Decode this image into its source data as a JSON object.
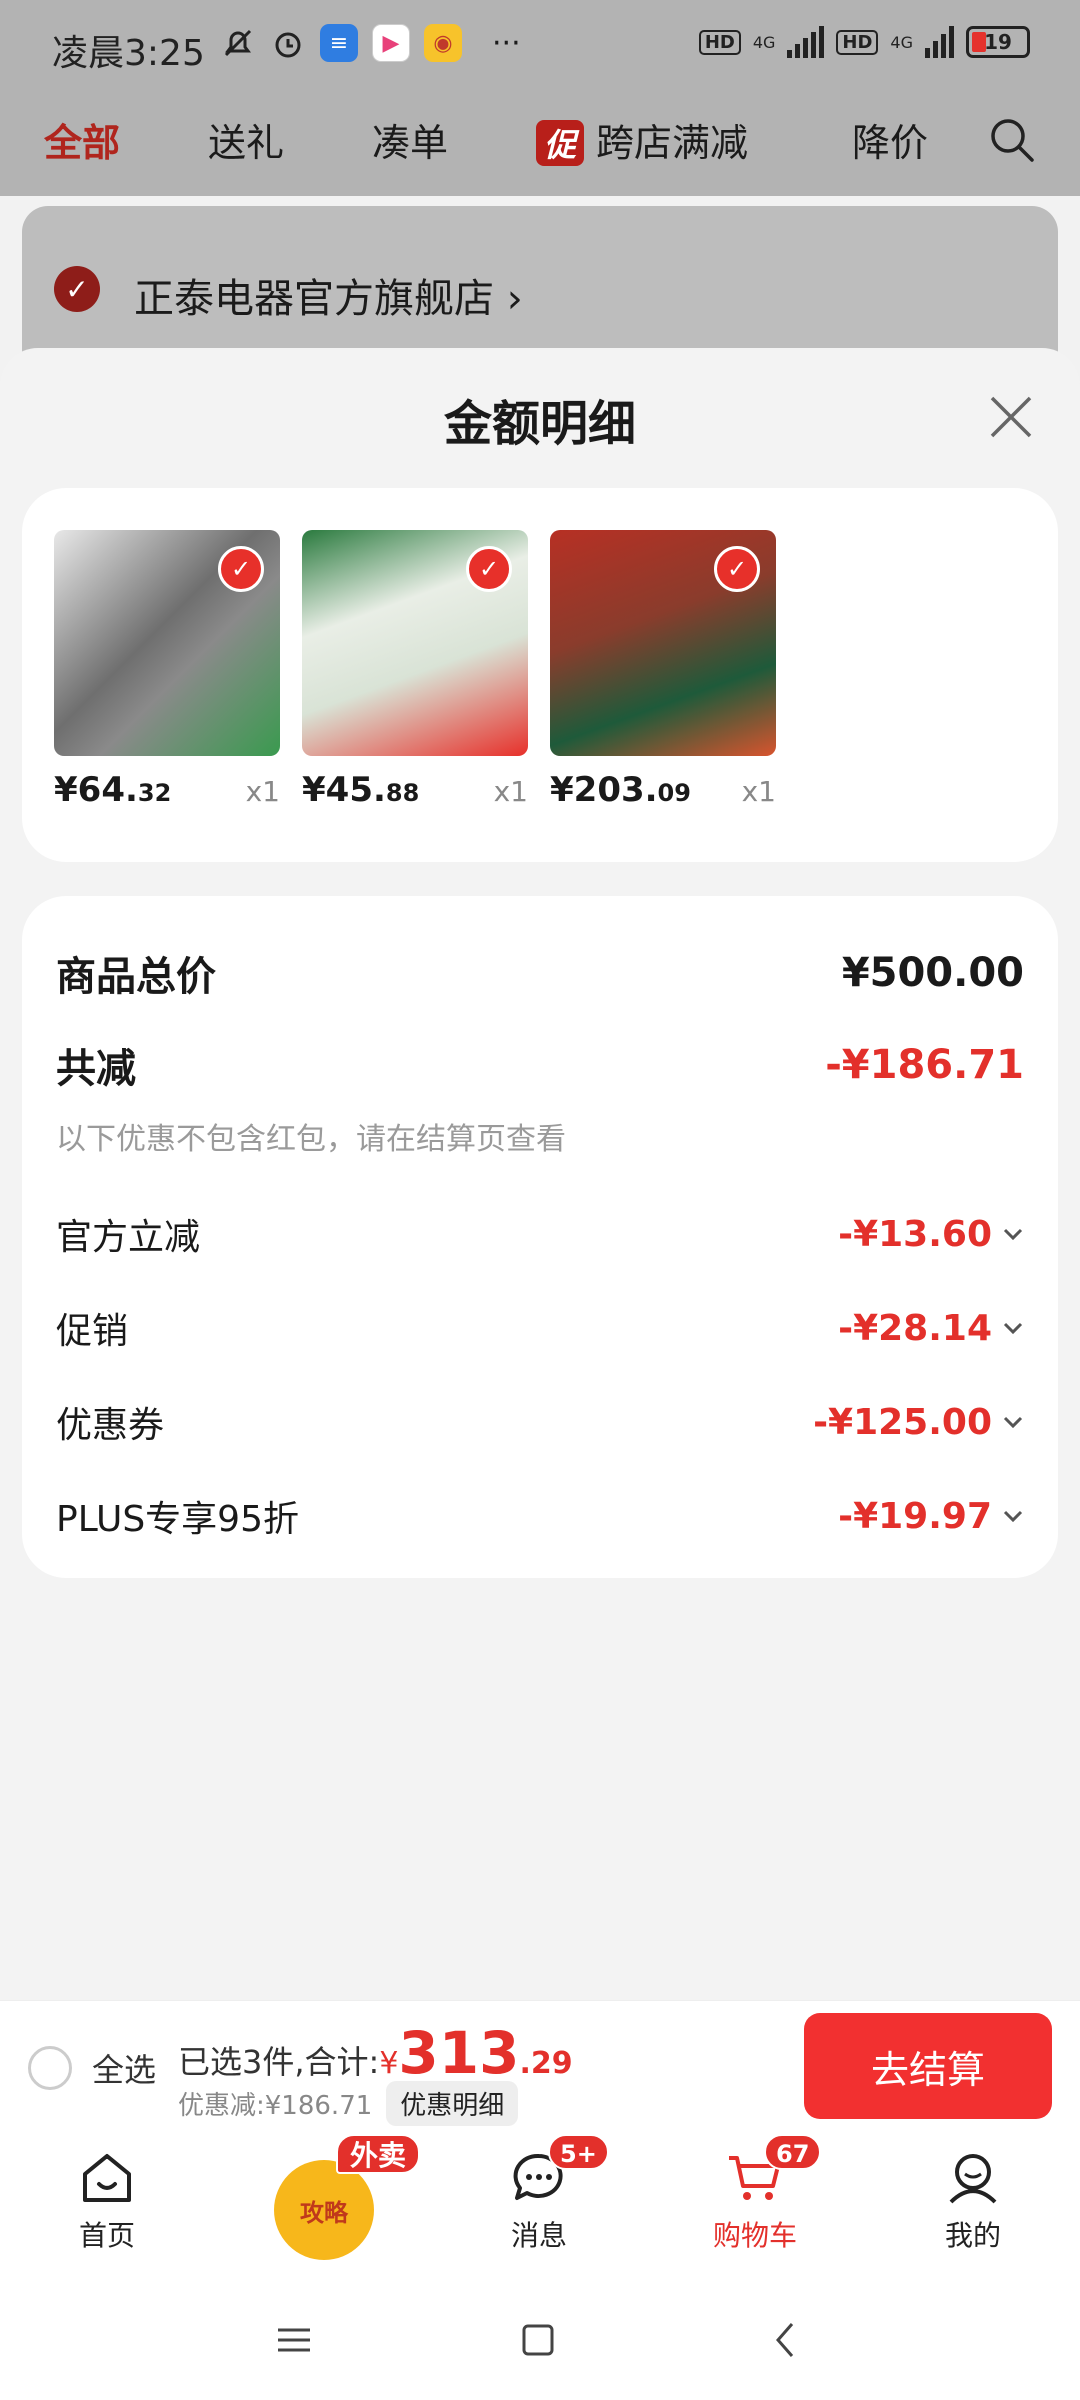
{
  "status": {
    "time": "凌晨3:25",
    "more": "···",
    "hd1": "HD",
    "net1": "4G",
    "hd2": "HD",
    "net2": "4G",
    "battery": "19"
  },
  "tabs": [
    {
      "label": "全部",
      "active": true
    },
    {
      "label": "送礼"
    },
    {
      "label": "凑单"
    },
    {
      "label": "跨店满减",
      "badge": "促"
    },
    {
      "label": "降价"
    }
  ],
  "store": {
    "name": "正泰电器官方旗舰店",
    "arrow": "›"
  },
  "sheet": {
    "title": "金额明细",
    "products": [
      {
        "price_int": "¥64.",
        "price_dec": "32",
        "qty": "x1",
        "colors": [
          "#6f6f6f",
          "#3a9a4f",
          "#e8e8e8"
        ]
      },
      {
        "price_int": "¥45.",
        "price_dec": "88",
        "qty": "x1",
        "colors": [
          "#2a7a3e",
          "#e7302a",
          "#f6e7c8"
        ]
      },
      {
        "price_int": "¥203.",
        "price_dec": "09",
        "qty": "x1",
        "colors": [
          "#b73024",
          "#1e5a3a",
          "#f1c94e"
        ]
      }
    ],
    "summary": {
      "total_label": "商品总价",
      "total_value": "¥500.00",
      "reduce_label": "共减",
      "reduce_value": "-¥186.71",
      "note": "以下优惠不包含红包，请在结算页查看",
      "rows": [
        {
          "label": "官方立减",
          "value": "-¥13.60"
        },
        {
          "label": "促销",
          "value": "-¥28.14"
        },
        {
          "label": "优惠券",
          "value": "-¥125.00"
        },
        {
          "label": "PLUS专享95折",
          "value": "-¥19.97"
        }
      ]
    }
  },
  "checkout": {
    "select_all": "全选",
    "summary_prefix": "已选3件,合计:",
    "currency": "¥",
    "total_int": "313",
    "total_dec": ".29",
    "discount": "优惠减:¥186.71",
    "detail": "优惠明细",
    "button": "去结算"
  },
  "navbar": {
    "home": "首页",
    "guide": "攻略",
    "waimai": "外卖",
    "messages": "消息",
    "messages_badge": "5+",
    "cart": "购物车",
    "cart_badge": "67",
    "mine": "我的"
  },
  "colors": {
    "accent": "#e3302b",
    "button": "#f23030"
  }
}
